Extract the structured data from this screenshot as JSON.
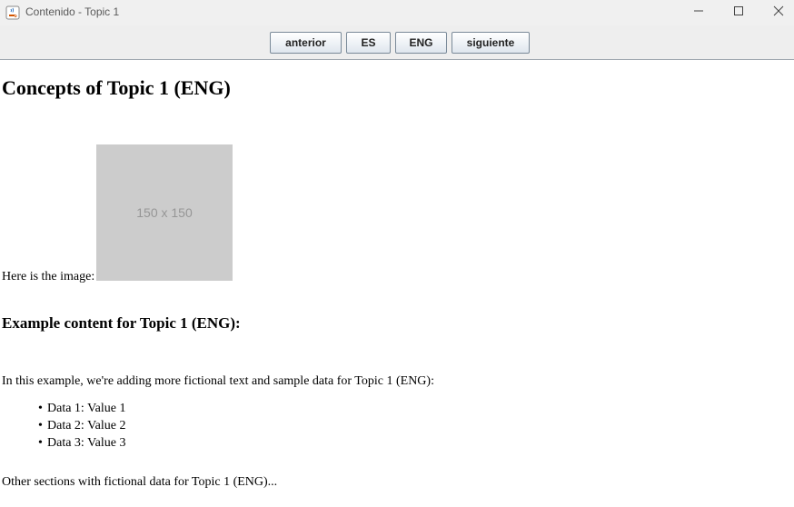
{
  "window": {
    "title": "Contenido - Topic 1"
  },
  "toolbar": {
    "prev_label": "anterior",
    "es_label": "ES",
    "eng_label": "ENG",
    "next_label": "siguiente"
  },
  "content": {
    "title": "Concepts of Topic 1 (ENG)",
    "image_label": "Here is the image:",
    "image_placeholder": "150 x 150",
    "section_heading": "Example content for Topic 1 (ENG):",
    "paragraph": "In this example, we're adding more fictional text and sample data for Topic 1 (ENG):",
    "list_items": [
      "Data 1: Value 1",
      "Data 2: Value 2",
      "Data 3: Value 3"
    ],
    "footer_text": "Other sections with fictional data for Topic 1 (ENG)..."
  },
  "icons": {
    "app": "java-coffee-icon",
    "minimize": "minimize-icon",
    "maximize": "maximize-icon",
    "close": "close-icon"
  },
  "colors": {
    "titlebar": "#f0f0f0",
    "toolbar": "#eeeeee",
    "placeholder_bg": "#cccccc",
    "placeholder_text": "#969696"
  }
}
